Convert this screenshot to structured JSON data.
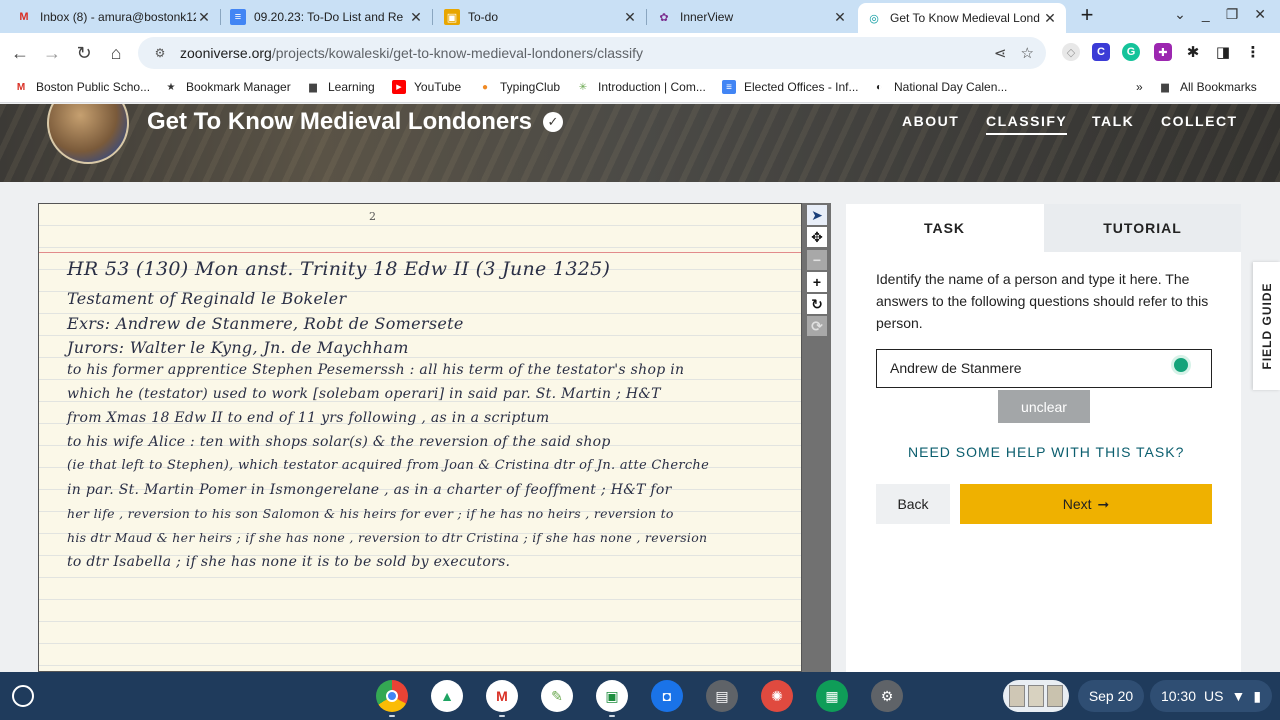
{
  "browser": {
    "tabs": [
      {
        "label": "Inbox (8) - amura@bostonk12",
        "icon": "gmail-icon",
        "glyph": "M",
        "color": "#d93025"
      },
      {
        "label": "09.20.23: To-Do List and Re",
        "icon": "docs-icon",
        "glyph": "≡",
        "color": "#4285f4"
      },
      {
        "label": "To-do",
        "icon": "classroom-icon",
        "glyph": "▣",
        "color": "#e8a600"
      },
      {
        "label": "InnerView",
        "icon": "innerview-icon",
        "glyph": "✿",
        "color": "#7b2e8e"
      },
      {
        "label": "Get To Know Medieval Lond",
        "icon": "zooniverse-icon",
        "glyph": "◎",
        "color": "#00979d"
      }
    ],
    "url_host": "zooniverse.org",
    "url_path": "/projects/kowaleski/get-to-know-medieval-londoners/classify",
    "bookmarks": [
      {
        "label": "Boston Public Scho...",
        "icon": "gmail-icon",
        "glyph": "M",
        "color": "#d93025"
      },
      {
        "label": "Bookmark Manager",
        "icon": "star-icon",
        "glyph": "★",
        "color": "#333333"
      },
      {
        "label": "Learning",
        "icon": "folder-icon",
        "glyph": "▆",
        "color": "#444444"
      },
      {
        "label": "YouTube",
        "icon": "youtube-icon",
        "glyph": "▶",
        "color": "#ff0000"
      },
      {
        "label": "TypingClub",
        "icon": "typingclub-icon",
        "glyph": "●",
        "color": "#f08a24"
      },
      {
        "label": "Introduction | Com...",
        "icon": "course-icon",
        "glyph": "✳",
        "color": "#6aa84f"
      },
      {
        "label": "Elected Offices - Inf...",
        "icon": "docs-icon",
        "glyph": "≡",
        "color": "#4285f4"
      },
      {
        "label": "National Day Calen...",
        "icon": "globe-icon",
        "glyph": "◐",
        "color": "#222222"
      },
      {
        "label": "All Bookmarks",
        "icon": "folder-icon",
        "glyph": "▆",
        "color": "#444444"
      }
    ],
    "bookmarks_overflow": "»"
  },
  "project": {
    "title": "Get To Know Medieval Londoners",
    "nav": [
      "ABOUT",
      "CLASSIFY",
      "TALK",
      "COLLECT"
    ],
    "active_nav": "CLASSIFY"
  },
  "subject": {
    "page_number": "2",
    "lines": [
      "HR 53 (130)    Mon   anst.  Trinity   18 Edw II    (3 June 1325)",
      "Testament  of   Reginald  le  Bokeler",
      "Exrs:  Andrew  de  Stanmere,  Robt de  Somersete",
      "Jurors:  Walter le  Kyng,  Jn. de  Maychham",
      "to  his former apprentice  Stephen  Pesemerssh :  all  his  term  of  the  testator's  shop  in",
      "which   he (testator)  used  to  work  [solebam operari]   in   said  par.  St. Martin ;  H&T",
      "from  Xmas  18 Edw II   to   end   of   11 yrs   following ,   as   in   a  scriptum",
      "to  his  wife  Alice  :   ten  with  shops   solar(s)   &  the  reversion  of  the  said  shop",
      "(ie that left to Stephen),  which  testator  acquired  from  Joan  &  Cristina  dtr of  Jn. atte  Cherche",
      "in  par.  St. Martin  Pomer    in   Ismongerelane ,   as   in  a  charter  of  feoffment ;  H&T  for",
      "her  life ,  reversion  to  his  son   Salomon   &  his  heirs  for  ever ;  if  he  has  no  heirs ,  reversion  to",
      "his  dtr  Maud  &  her  heirs ;  if  she  has  none ,  reversion  to  dtr  Cristina ; if  she  has  none ,  reversion",
      "to  dtr  Isabella ;   if  she  has  none   it  is   to  be  sold   by  executors."
    ]
  },
  "task": {
    "tab_task": "TASK",
    "tab_tutorial": "TUTORIAL",
    "instruction": "Identify the name of a person and type it here. The answers to the following questions should refer to this person.",
    "answer_value": "Andrew de Stanmere",
    "unclear_label": "unclear",
    "help_link": "NEED SOME HELP WITH THIS TASK?",
    "back_label": "Back",
    "next_label": "Next",
    "field_guide_label": "FIELD GUIDE"
  },
  "image_tools": [
    "pointer-icon",
    "move-icon",
    "zoom-out-icon",
    "zoom-in-icon",
    "rotate-icon",
    "reset-icon"
  ],
  "shelf": {
    "apps": [
      {
        "name": "chrome-icon",
        "color": "#e94235",
        "glyph": "◉"
      },
      {
        "name": "drive-icon",
        "color": "#1fa463",
        "glyph": "▲"
      },
      {
        "name": "gmail-icon",
        "color": "#ffffff",
        "glyph": "M"
      },
      {
        "name": "kami-icon",
        "color": "#6aa84f",
        "glyph": "✎"
      },
      {
        "name": "classroom-icon",
        "color": "#1e8e3e",
        "glyph": "▣"
      },
      {
        "name": "camera-icon",
        "color": "#1a73e8",
        "glyph": "◘"
      },
      {
        "name": "print-icon",
        "color": "#5f6368",
        "glyph": "▤"
      },
      {
        "name": "palette-icon",
        "color": "#e04a3f",
        "glyph": "✺"
      },
      {
        "name": "forms-icon",
        "color": "#0f9d58",
        "glyph": "▦"
      },
      {
        "name": "settings-icon",
        "color": "#5f6368",
        "glyph": "⚙"
      }
    ],
    "date": "Sep 20",
    "time": "10:30",
    "locale": "US"
  }
}
